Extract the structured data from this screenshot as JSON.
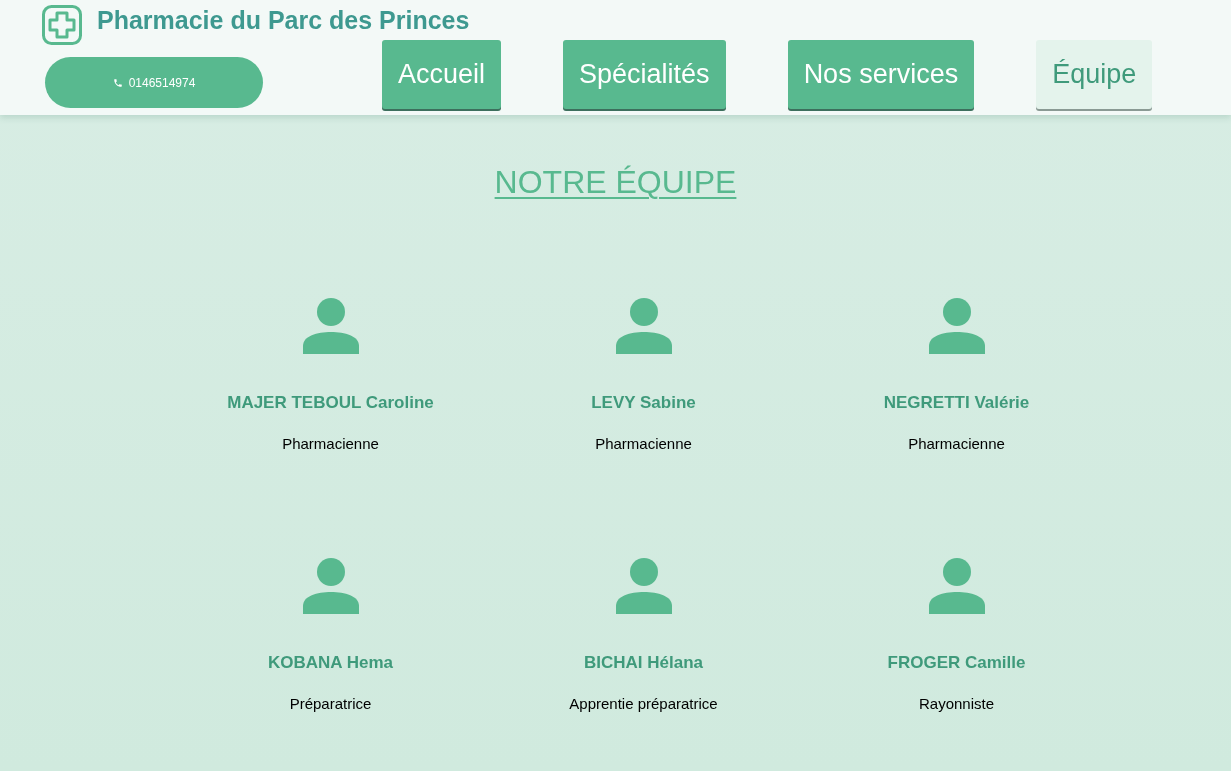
{
  "header": {
    "title": "Pharmacie du Parc des Princes",
    "phone": "0146514974"
  },
  "nav": [
    {
      "label": "Accueil",
      "selected": false
    },
    {
      "label": "Spécialités",
      "selected": false
    },
    {
      "label": "Nos services",
      "selected": false
    },
    {
      "label": "Équipe",
      "selected": true
    }
  ],
  "page_title": "NOTRE ÉQUIPE",
  "team": [
    {
      "name": "MAJER TEBOUL Caroline",
      "role": "Pharmacienne"
    },
    {
      "name": "LEVY Sabine",
      "role": "Pharmacienne"
    },
    {
      "name": "NEGRETTI Valérie",
      "role": "Pharmacienne"
    },
    {
      "name": "KOBANA Hema",
      "role": "Préparatrice"
    },
    {
      "name": "BICHAI Hélana",
      "role": "Apprentie préparatrice"
    },
    {
      "name": "FROGER Camille",
      "role": "Rayonniste"
    }
  ]
}
